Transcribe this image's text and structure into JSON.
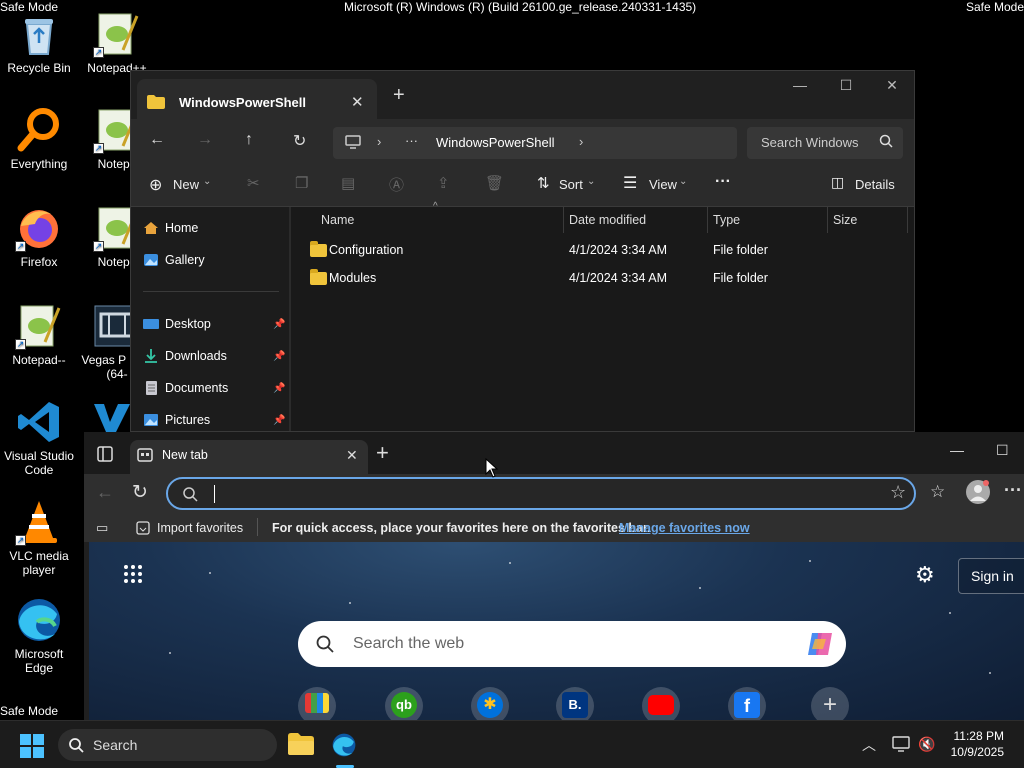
{
  "desktop": {
    "top_left_label": "Safe Mode",
    "top_right_label": "Safe Mode",
    "bottom_left_label": "Safe Mode",
    "build_text": "Microsoft (R) Windows (R) (Build 26100.ge_release.240331-1435)",
    "icons": [
      {
        "label": "Recycle Bin"
      },
      {
        "label": "Notepad++"
      },
      {
        "label": "Everything"
      },
      {
        "label": "Notepa"
      },
      {
        "label": "Firefox"
      },
      {
        "label": "Notepa"
      },
      {
        "label": "Notepad--"
      },
      {
        "label": "Vegas P 13.0 (64-"
      },
      {
        "label": "Visual Studio Code"
      },
      {
        "label": "VLC media player"
      },
      {
        "label": "Microsoft Edge"
      }
    ]
  },
  "explorer": {
    "tab_title": "WindowsPowerShell",
    "address": {
      "more": "···",
      "folder": "WindowsPowerShell"
    },
    "search_placeholder": "Search Windows",
    "toolbar": {
      "new": "New",
      "sort": "Sort",
      "view": "View",
      "more": "···",
      "details": "Details"
    },
    "nav": [
      {
        "label": "Home"
      },
      {
        "label": "Gallery"
      },
      {
        "label": "Desktop"
      },
      {
        "label": "Downloads"
      },
      {
        "label": "Documents"
      },
      {
        "label": "Pictures"
      }
    ],
    "columns": [
      "Name",
      "Date modified",
      "Type",
      "Size"
    ],
    "rows": [
      {
        "name": "Configuration",
        "date": "4/1/2024 3:34 AM",
        "type": "File folder",
        "size": ""
      },
      {
        "name": "Modules",
        "date": "4/1/2024 3:34 AM",
        "type": "File folder",
        "size": ""
      }
    ]
  },
  "edge": {
    "tab_title": "New tab",
    "omnibox_value": "",
    "favorites_bar": {
      "import": "Import favorites",
      "hint": "For quick access, place your favorites here on the favorites bar.",
      "manage_link": "Manage favorites now"
    },
    "ntp": {
      "sign_in": "Sign in",
      "search_placeholder": "Search the web",
      "quick_links": [
        {
          "letter": "",
          "color": "#2a2a2a"
        },
        {
          "letter": "qb",
          "color": "#2ca01c"
        },
        {
          "letter": "✱",
          "color": "#0071dc"
        },
        {
          "letter": "B.",
          "color": "#003580"
        },
        {
          "letter": "▶",
          "color": "#ff0000"
        },
        {
          "letter": "f",
          "color": "#1877f2"
        },
        {
          "letter": "+",
          "color": "#555555"
        }
      ]
    }
  },
  "taskbar": {
    "search_label": "Search",
    "time": "11:28 PM",
    "date": "10/9/2025"
  },
  "colors": {
    "accent": "#6aa7e8",
    "link": "#6aa7e8",
    "folder": "#f0c43b"
  }
}
